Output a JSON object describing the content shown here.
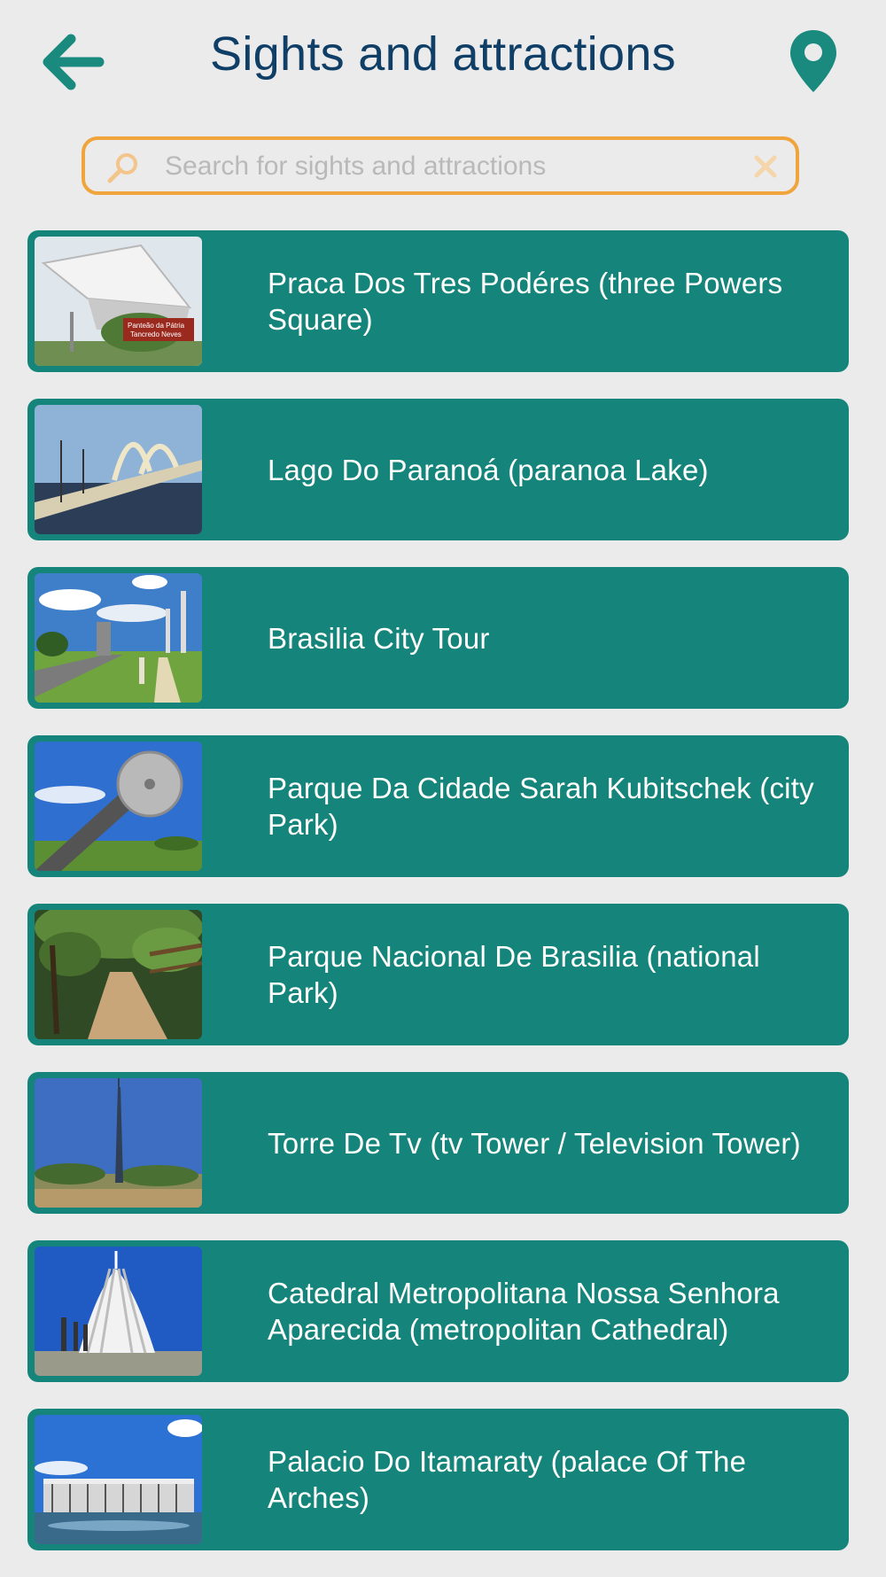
{
  "header": {
    "title": "Sights and attractions",
    "back_icon": "arrow-left-icon",
    "map_icon": "map-pin-icon"
  },
  "search": {
    "placeholder": "Search for sights and attractions",
    "value": "",
    "search_icon": "magnifier-icon",
    "clear_icon": "close-icon"
  },
  "colors": {
    "background": "#ebebeb",
    "card": "#15857b",
    "title": "#0f3e66",
    "accent": "#1a8a7f",
    "search_border": "#f0a43c"
  },
  "items": [
    {
      "label": "Praca Dos Tres Podéres (three Powers Square)",
      "thumb_sign_line1": "Panteão da Pátria",
      "thumb_sign_line2": "Tancredo Neves"
    },
    {
      "label": "Lago Do Paranoá (paranoa Lake)"
    },
    {
      "label": "Brasilia City Tour"
    },
    {
      "label": "Parque Da Cidade Sarah Kubitschek (city Park)"
    },
    {
      "label": "Parque Nacional De Brasilia (national Park)"
    },
    {
      "label": "Torre De Tv (tv Tower / Television Tower)"
    },
    {
      "label": "Catedral Metropolitana Nossa Senhora Aparecida (metropolitan Cathedral)"
    },
    {
      "label": "Palacio Do Itamaraty (palace Of The Arches)"
    }
  ]
}
